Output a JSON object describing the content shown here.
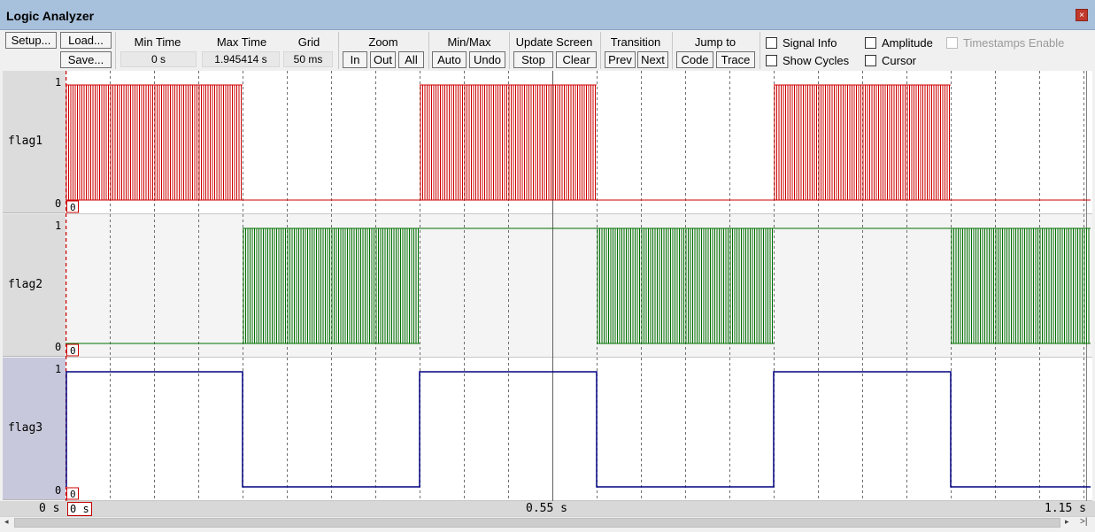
{
  "window": {
    "title": "Logic Analyzer",
    "close_glyph": "×"
  },
  "toolbar": {
    "setup": "Setup...",
    "load": "Load...",
    "save": "Save...",
    "min_time_label": "Min Time",
    "min_time_value": "0 s",
    "max_time_label": "Max Time",
    "max_time_value": "1.945414 s",
    "grid_label": "Grid",
    "grid_value": "50 ms",
    "zoom_label": "Zoom",
    "zoom_in": "In",
    "zoom_out": "Out",
    "zoom_all": "All",
    "minmax_label": "Min/Max",
    "auto": "Auto",
    "undo": "Undo",
    "update_label": "Update Screen",
    "stop": "Stop",
    "clear": "Clear",
    "transition_label": "Transition",
    "prev": "Prev",
    "next": "Next",
    "jump_label": "Jump to",
    "code": "Code",
    "trace": "Trace"
  },
  "options": {
    "signal_info": "Signal Info",
    "show_cycles": "Show Cycles",
    "amplitude": "Amplitude",
    "cursor": "Cursor",
    "timestamps_enable": "Timestamps Enable"
  },
  "signals": [
    {
      "name": "flag1",
      "color": "#cc0000",
      "high": "1",
      "low": "0"
    },
    {
      "name": "flag2",
      "color": "#007000",
      "high": "1",
      "low": "0"
    },
    {
      "name": "flag3",
      "color": "#000080",
      "high": "1",
      "low": "0"
    }
  ],
  "signal_zero_marker": "0",
  "time_axis": {
    "left": "0 s",
    "start_box": "0 s",
    "mid": "0.55 s",
    "end": "1.15 s"
  },
  "scroll": {
    "left_arrow": "◂",
    "right_arrow": "▸",
    "end_marker": ">|"
  }
}
